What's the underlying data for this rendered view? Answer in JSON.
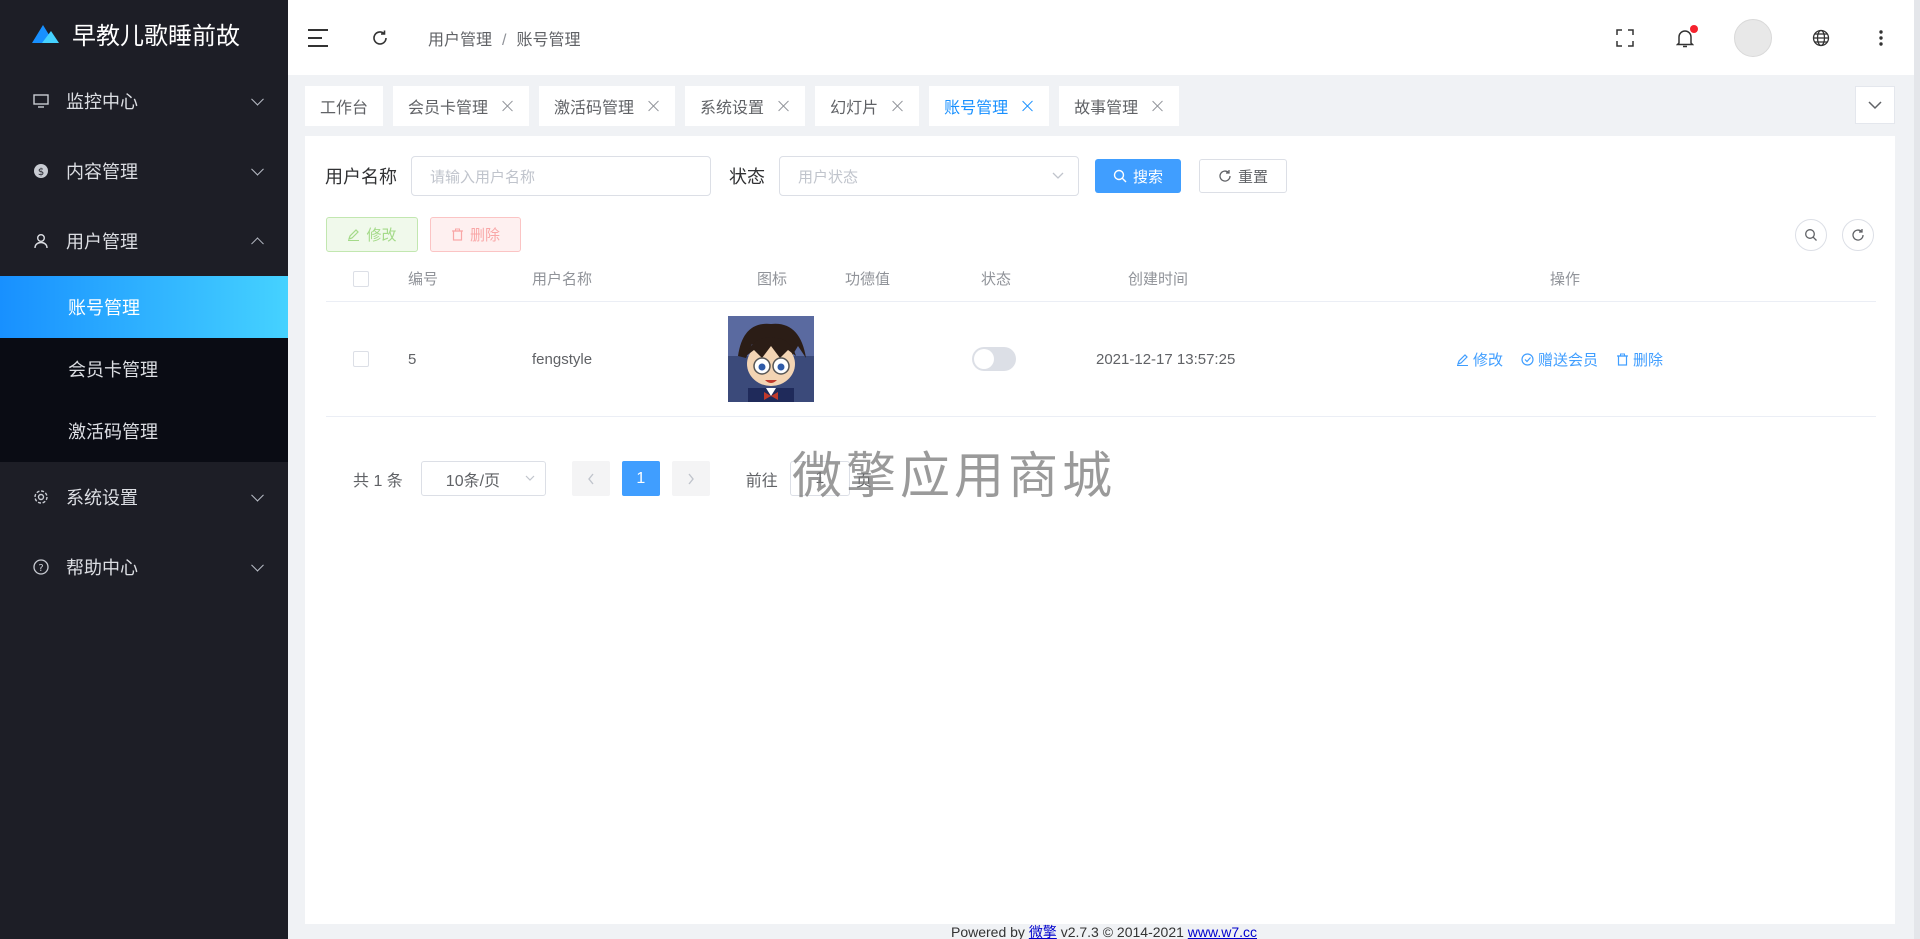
{
  "app": {
    "title": "早教儿歌睡前故"
  },
  "sidebar": {
    "menu": [
      {
        "label": "监控中心",
        "icon": "monitor-icon"
      },
      {
        "label": "内容管理",
        "icon": "dollar-circle-icon"
      },
      {
        "label": "用户管理",
        "icon": "user-icon",
        "expanded": true
      },
      {
        "label": "系统设置",
        "icon": "gear-icon"
      },
      {
        "label": "帮助中心",
        "icon": "help-circle-icon"
      }
    ],
    "user_sub": [
      {
        "label": "账号管理",
        "active": true
      },
      {
        "label": "会员卡管理"
      },
      {
        "label": "激活码管理"
      }
    ]
  },
  "header": {
    "breadcrumb": [
      "用户管理",
      "账号管理"
    ],
    "breadcrumb_sep": "/"
  },
  "tabs": [
    {
      "label": "工作台",
      "closable": false
    },
    {
      "label": "会员卡管理",
      "closable": true
    },
    {
      "label": "激活码管理",
      "closable": true
    },
    {
      "label": "系统设置",
      "closable": true
    },
    {
      "label": "幻灯片",
      "closable": true
    },
    {
      "label": "账号管理",
      "closable": true,
      "active": true
    },
    {
      "label": "故事管理",
      "closable": true
    }
  ],
  "search": {
    "username_label": "用户名称",
    "username_placeholder": "请输入用户名称",
    "status_label": "状态",
    "status_placeholder": "用户状态",
    "search_btn": "搜索",
    "reset_btn": "重置"
  },
  "toolbar": {
    "edit": "修改",
    "delete": "删除"
  },
  "table": {
    "columns": [
      "编号",
      "用户名称",
      "图标",
      "功德值",
      "状态",
      "创建时间",
      "操作"
    ],
    "rows": [
      {
        "id": "5",
        "username": "fengstyle",
        "merit": "",
        "status_on": false,
        "created": "2021-12-17 13:57:25"
      }
    ],
    "ops": [
      "修改",
      "赠送会员",
      "删除"
    ]
  },
  "pagination": {
    "total": "共 1 条",
    "page_size": "10条/页",
    "current": "1",
    "goto_prefix": "前往",
    "goto_value": "1",
    "goto_suffix": "页"
  },
  "watermark": "微擎应用商城",
  "footer": {
    "prefix": "Powered by ",
    "brand": "微擎",
    "version": " v2.7.3 © 2014-2021 ",
    "link": "www.w7.cc"
  },
  "colors": {
    "primary": "#409eff",
    "sidebar_bg": "#1d1e26",
    "active_gradient_start": "#1890ff",
    "active_gradient_end": "#45d2ff"
  }
}
